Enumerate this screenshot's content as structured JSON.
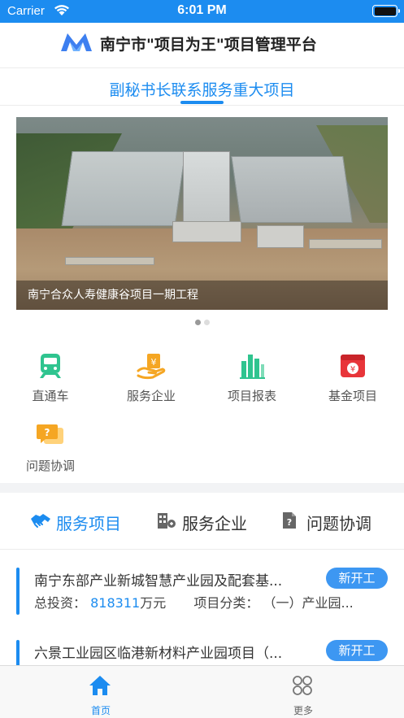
{
  "status_bar": {
    "carrier": "Carrier",
    "time": "6:01 PM"
  },
  "header": {
    "title": "南宁市\"项目为王\"项目管理平台"
  },
  "section_tab": {
    "label": "副秘书长联系服务重大项目"
  },
  "banner": {
    "caption": "南宁合众人寿健康谷项目一期工程",
    "page_count": 2,
    "active_page": 1
  },
  "grid": {
    "items": [
      {
        "label": "直通车",
        "icon": "train-icon"
      },
      {
        "label": "服务企业",
        "icon": "hand-service-icon"
      },
      {
        "label": "项目报表",
        "icon": "bar-report-icon"
      },
      {
        "label": "基金项目",
        "icon": "fund-icon"
      },
      {
        "label": "问题协调",
        "icon": "question-chat-icon"
      }
    ]
  },
  "service_tabs": [
    {
      "label": "服务项目",
      "icon": "handshake-icon",
      "active": true
    },
    {
      "label": "服务企业",
      "icon": "building-icon",
      "active": false
    },
    {
      "label": "问题协调",
      "icon": "document-question-icon",
      "active": false
    }
  ],
  "projects": [
    {
      "name": "南宁东部产业新城智慧产业园及配套基...",
      "badge": "新开工",
      "investment_label": "总投资：",
      "investment_value": "818311",
      "investment_unit": "万元",
      "category_label": "项目分类：",
      "category_value": "（一）产业园..."
    },
    {
      "name": "六景工业园区临港新材料产业园项目（...",
      "badge": "新开工"
    }
  ],
  "tabbar": [
    {
      "label": "首页",
      "icon": "home-icon",
      "active": true
    },
    {
      "label": "更多",
      "icon": "more-icon",
      "active": false
    }
  ],
  "colors": {
    "primary": "#1c8cf0",
    "badge": "#3d97f2",
    "train": "#2fc48f",
    "service": "#f5a623",
    "report": "#2fc48f",
    "fund": "#e8353a",
    "question": "#f5a623"
  }
}
